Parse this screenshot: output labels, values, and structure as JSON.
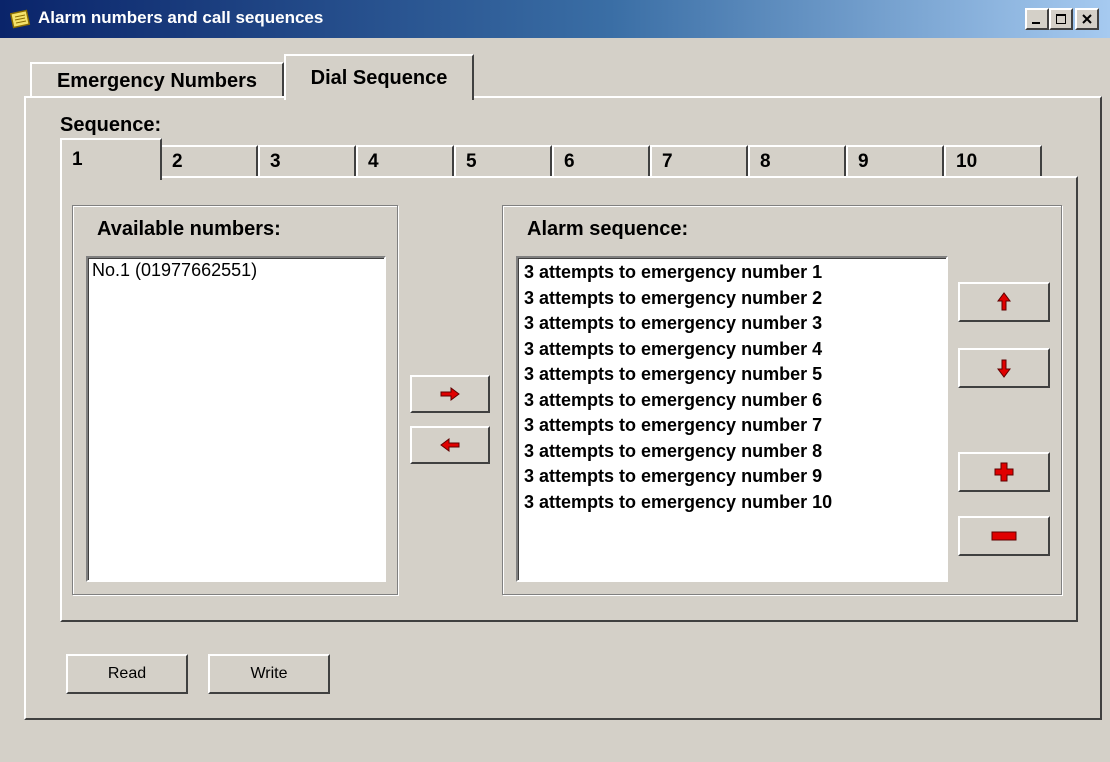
{
  "window": {
    "title": "Alarm numbers and call sequences",
    "controls": [
      "minimize-icon",
      "maximize-icon",
      "close-icon"
    ]
  },
  "tabs": [
    {
      "label": "Emergency Numbers",
      "active": false
    },
    {
      "label": "Dial Sequence",
      "active": true
    }
  ],
  "sequence": {
    "label": "Sequence:",
    "tabs": [
      "1",
      "2",
      "3",
      "4",
      "5",
      "6",
      "7",
      "8",
      "9",
      "10"
    ],
    "active_index": 0
  },
  "available": {
    "label": "Available numbers:",
    "items": [
      "No.1 (01977662551)"
    ]
  },
  "alarm": {
    "label": "Alarm sequence:",
    "items": [
      "3 attempts to emergency number 1",
      "3 attempts to emergency number 2",
      "3 attempts to emergency number 3",
      "3 attempts to emergency number 4",
      "3 attempts to emergency number 5",
      "3 attempts to emergency number 6",
      "3 attempts to emergency number 7",
      "3 attempts to emergency number 8",
      "3 attempts to emergency number 9",
      "3 attempts to emergency number 10"
    ]
  },
  "buttons": {
    "read": "Read",
    "write": "Write"
  },
  "icons": {
    "add_to_sequence": "arrow-right-icon",
    "remove_from_sequence": "arrow-left-icon",
    "move_up": "arrow-up-icon",
    "move_down": "arrow-down-icon",
    "add_item": "plus-icon",
    "remove_item": "minus-icon"
  },
  "colors": {
    "title_bar_start": "#0a246a",
    "title_bar_end": "#a6caf0",
    "face": "#d4d0c8",
    "icon_red": "#e00000"
  }
}
